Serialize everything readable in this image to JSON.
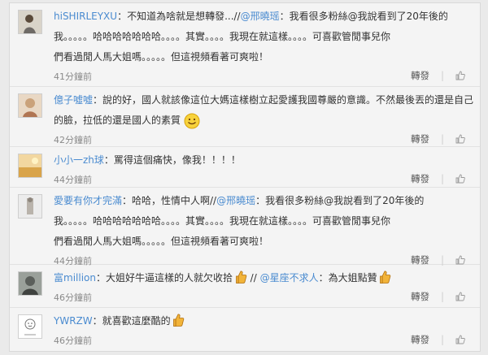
{
  "actions": {
    "repost_label": "轉發"
  },
  "comments": [
    {
      "user": "hiSHIRLEYXU",
      "text_1": "：不知道為啥就是想轉發...//",
      "mention_1": "@邢曉瑶",
      "text_2": "：我看很多粉絲@我說看到了20年後的",
      "line_2": "我。。。。。哈哈哈哈哈哈哈。。。。其實。。。。我現在就這樣。。。。可喜歡管閒事兒你",
      "line_3": "們看過閒人馬大姐嗎。。。。。但這視頻看著可爽啦！",
      "time": "41分鐘前"
    },
    {
      "user": "億子噓噓",
      "text_1": "：說的好，國人就該像這位大媽這樣樹立起愛護我國尊嚴的意識。不然最後丟的還是自己",
      "line_2": "的臉，拉低的還是國人的素質",
      "time": "42分鐘前"
    },
    {
      "user": "小小一zh球",
      "text_1": "：罵得這個痛快，像我！！！！",
      "time": "44分鐘前"
    },
    {
      "user": "愛要有你才完滿",
      "text_1": "：哈哈，性情中人啊//",
      "mention_1": "@邢曉瑶",
      "text_2": "：我看很多粉絲@我說看到了20年後的",
      "line_2": "我。。。。。哈哈哈哈哈哈哈。。。。其實。。。。我現在就這樣。。。。可喜歡管閒事兒你",
      "line_3": "們看過閒人馬大姐嗎。。。。。但這視頻看著可爽啦！",
      "time": "44分鐘前"
    },
    {
      "user": "富million",
      "text_1": "：大姐好牛逼這樣的人就欠收拾",
      "text_2": "//",
      "mention_1": "@星座不求人",
      "text_3": "：為大姐點贊",
      "time": "46分鐘前"
    },
    {
      "user": "YWRZW",
      "text_1": "：就喜歡這麼酷的",
      "time": "46分鐘前"
    }
  ]
}
